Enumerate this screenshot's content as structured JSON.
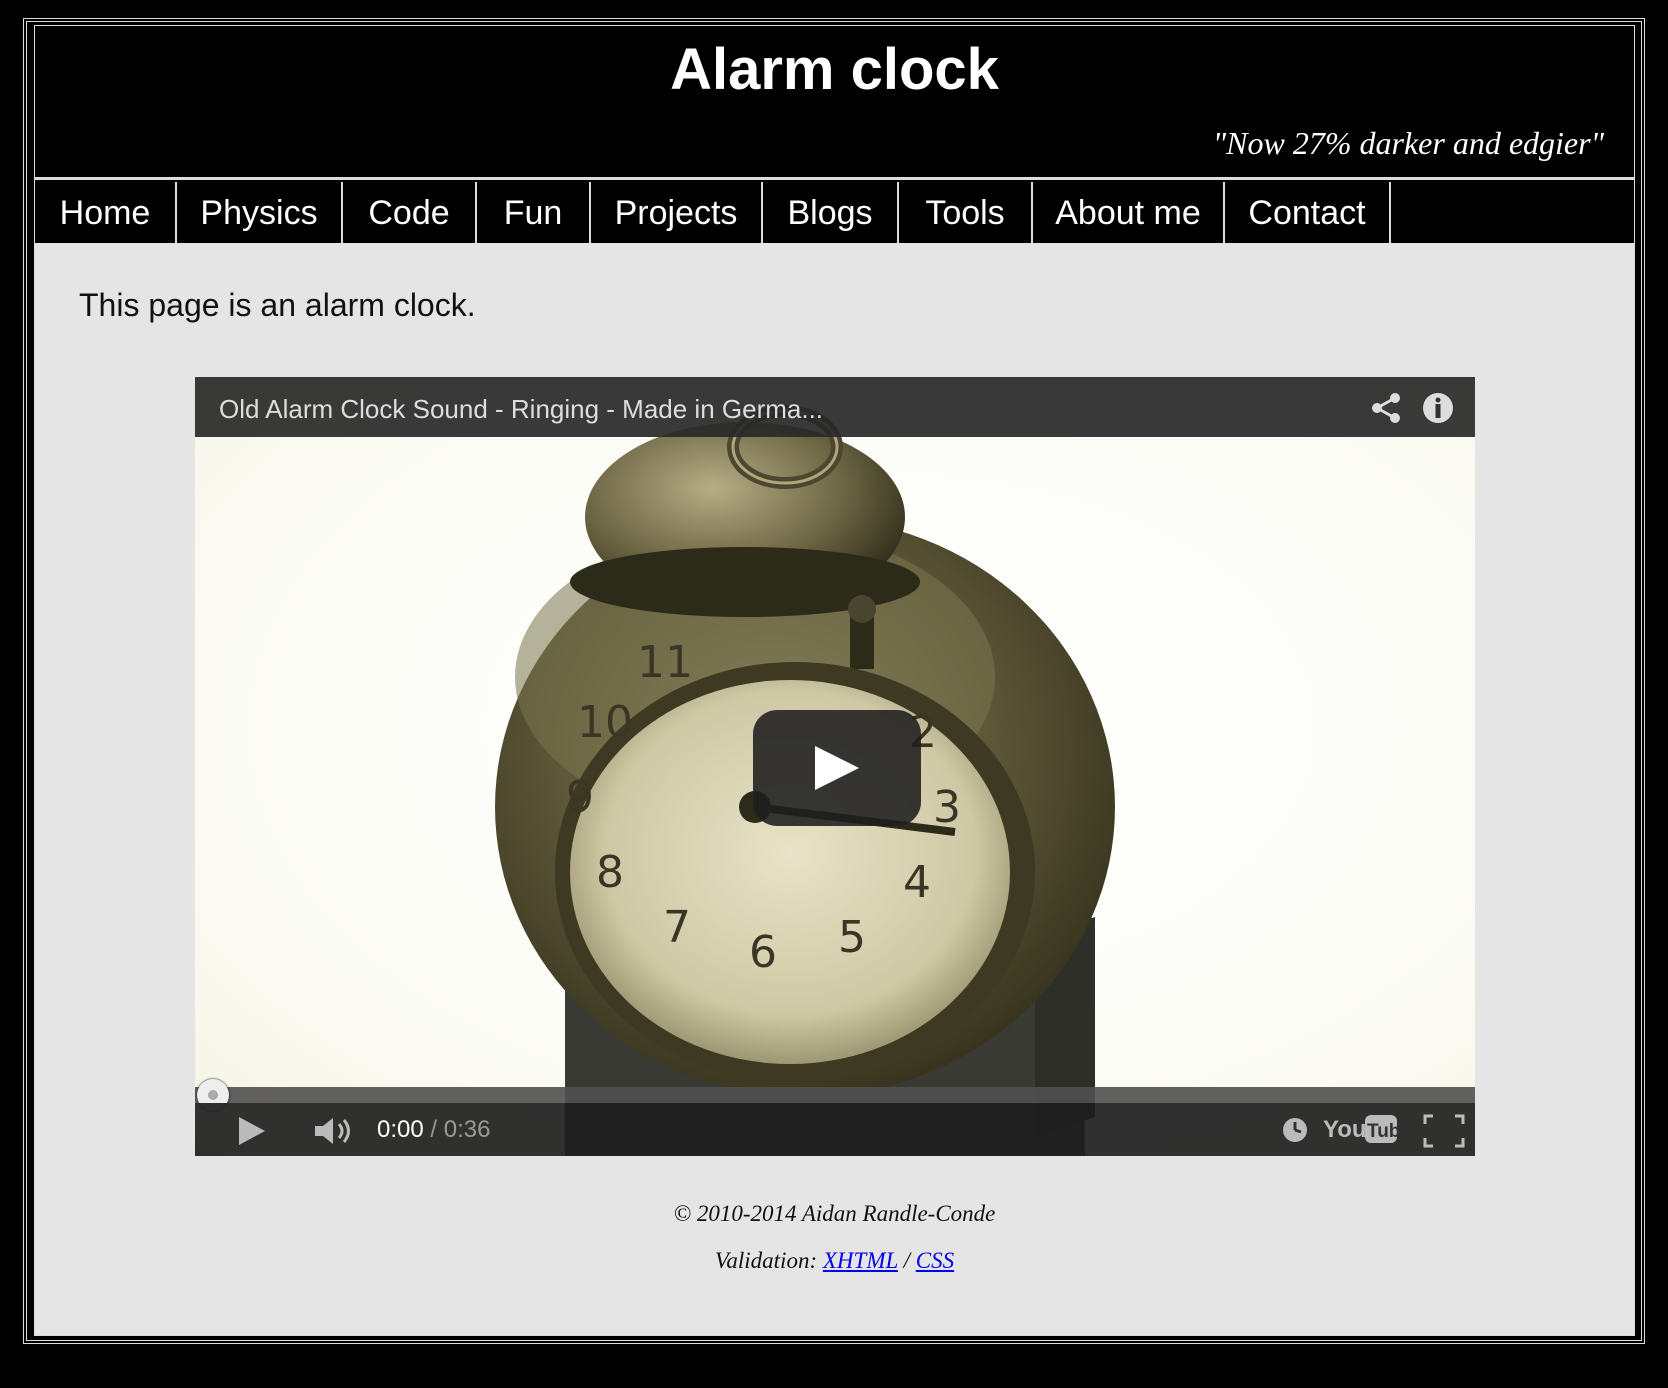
{
  "header": {
    "title": "Alarm clock",
    "tagline": "\"Now 27% darker and edgier\""
  },
  "nav": {
    "items": [
      {
        "label": "Home"
      },
      {
        "label": "Physics"
      },
      {
        "label": "Code"
      },
      {
        "label": "Fun"
      },
      {
        "label": "Projects"
      },
      {
        "label": "Blogs"
      },
      {
        "label": "Tools"
      },
      {
        "label": "About me"
      },
      {
        "label": "Contact"
      }
    ]
  },
  "main": {
    "intro": "This page is an alarm clock."
  },
  "video": {
    "title": "Old Alarm Clock Sound - Ringing - Made in Germa...",
    "current_time": "0:00",
    "separator": " / ",
    "duration": "0:36",
    "progress": 0,
    "icons": [
      "share-icon",
      "info-icon",
      "play-icon",
      "volume-icon",
      "watch-later-icon",
      "youtube-logo",
      "fullscreen-icon"
    ]
  },
  "footer": {
    "copyright": "© 2010-2014 Aidan Randle-Conde",
    "validation_label": "Validation:",
    "xhtml_link": "XHTML",
    "link_separator": "/",
    "css_link": "CSS"
  },
  "colors": {
    "background": "#000000",
    "content_bg": "#e5e5e5",
    "link": "#0000ee",
    "progress": "#ee0000"
  }
}
